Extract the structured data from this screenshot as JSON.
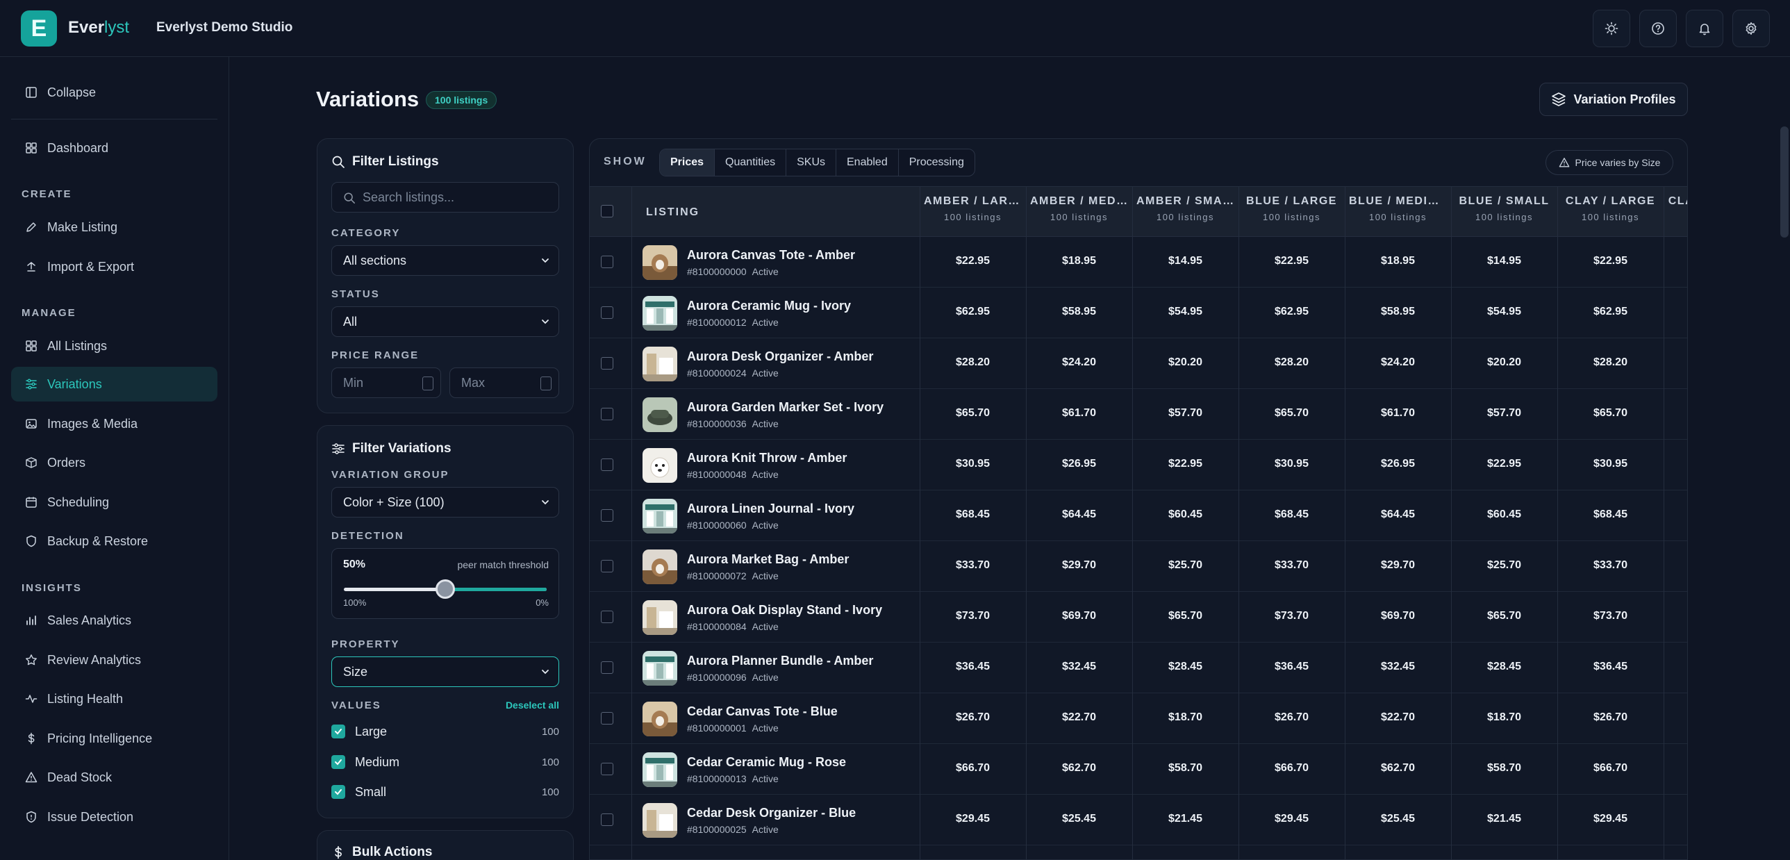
{
  "app": {
    "logo_letter": "E",
    "brand_main": "Ever",
    "brand_accent": "lyst",
    "studio": "Everlyst Demo Studio",
    "top_icons": [
      "sun-icon",
      "help-icon",
      "bell-icon",
      "gear-icon"
    ]
  },
  "sidebar": {
    "collapse": "Collapse",
    "dashboard": "Dashboard",
    "sections": {
      "create": "CREATE",
      "manage": "MANAGE",
      "insights": "INSIGHTS"
    },
    "create_items": [
      "Make Listing",
      "Import & Export"
    ],
    "manage_items": [
      "All Listings",
      "Variations",
      "Images & Media",
      "Orders",
      "Scheduling",
      "Backup & Restore"
    ],
    "insights_items": [
      "Sales Analytics",
      "Review Analytics",
      "Listing Health",
      "Pricing Intelligence",
      "Dead Stock",
      "Issue Detection"
    ],
    "active": "Variations"
  },
  "header": {
    "title": "Variations",
    "badge": "100 listings",
    "profiles_button": "Variation Profiles"
  },
  "filter_listings": {
    "title": "Filter Listings",
    "search_placeholder": "Search listings...",
    "category_label": "CATEGORY",
    "category_value": "All sections",
    "status_label": "STATUS",
    "status_value": "All",
    "price_label": "PRICE RANGE",
    "min_placeholder": "Min",
    "max_placeholder": "Max"
  },
  "filter_variations": {
    "title": "Filter Variations",
    "group_label": "VARIATION GROUP",
    "group_value": "Color + Size (100)",
    "detection_label": "DETECTION",
    "threshold_value": "50%",
    "threshold_caption": "peer match threshold",
    "threshold_fraction": 0.5,
    "slider_left": "100%",
    "slider_right": "0%",
    "property_label": "PROPERTY",
    "property_value": "Size",
    "values_label": "VALUES",
    "deselect_all": "Deselect all",
    "values": [
      {
        "label": "Large",
        "count": "100"
      },
      {
        "label": "Medium",
        "count": "100"
      },
      {
        "label": "Small",
        "count": "100"
      }
    ]
  },
  "bulk_actions": {
    "title": "Bulk Actions"
  },
  "toolbar": {
    "show_label": "SHOW",
    "tabs": [
      "Prices",
      "Quantities",
      "SKUs",
      "Enabled",
      "Processing"
    ],
    "active_tab": "Prices",
    "price_varies": "Price varies by Size"
  },
  "table": {
    "listing_header": "LISTING",
    "columns": [
      {
        "label": "AMBER / LARGE",
        "sub": "100 listings"
      },
      {
        "label": "AMBER / MEDIUM",
        "sub": "100 listings"
      },
      {
        "label": "AMBER / SMALL",
        "sub": "100 listings"
      },
      {
        "label": "BLUE / LARGE",
        "sub": "100 listings"
      },
      {
        "label": "BLUE / MEDIUM",
        "sub": "100 listings"
      },
      {
        "label": "BLUE / SMALL",
        "sub": "100 listings"
      },
      {
        "label": "CLAY / LARGE",
        "sub": "100 listings"
      },
      {
        "label": "CLAY / MEDIUM",
        "sub": ""
      }
    ],
    "rows": [
      {
        "name": "Aurora Canvas Tote - Amber",
        "id": "#8100000000",
        "status": "Active",
        "thumb": "cat",
        "prices": [
          "$22.95",
          "$18.95",
          "$14.95",
          "$22.95",
          "$18.95",
          "$14.95",
          "$22.95"
        ]
      },
      {
        "name": "Aurora Ceramic Mug - Ivory",
        "id": "#8100000012",
        "status": "Active",
        "thumb": "shop",
        "prices": [
          "$62.95",
          "$58.95",
          "$54.95",
          "$62.95",
          "$58.95",
          "$54.95",
          "$62.95"
        ]
      },
      {
        "name": "Aurora Desk Organizer - Amber",
        "id": "#8100000024",
        "status": "Active",
        "thumb": "room",
        "prices": [
          "$28.20",
          "$24.20",
          "$20.20",
          "$28.20",
          "$24.20",
          "$20.20",
          "$28.20"
        ]
      },
      {
        "name": "Aurora Garden Marker Set - Ivory",
        "id": "#8100000036",
        "status": "Active",
        "thumb": "hat",
        "prices": [
          "$65.70",
          "$61.70",
          "$57.70",
          "$65.70",
          "$61.70",
          "$57.70",
          "$65.70"
        ]
      },
      {
        "name": "Aurora Knit Throw - Amber",
        "id": "#8100000048",
        "status": "Active",
        "thumb": "dog",
        "prices": [
          "$30.95",
          "$26.95",
          "$22.95",
          "$30.95",
          "$26.95",
          "$22.95",
          "$30.95"
        ]
      },
      {
        "name": "Aurora Linen Journal - Ivory",
        "id": "#8100000060",
        "status": "Active",
        "thumb": "shop",
        "prices": [
          "$68.45",
          "$64.45",
          "$60.45",
          "$68.45",
          "$64.45",
          "$60.45",
          "$68.45"
        ]
      },
      {
        "name": "Aurora Market Bag - Amber",
        "id": "#8100000072",
        "status": "Active",
        "thumb": "cat2",
        "prices": [
          "$33.70",
          "$29.70",
          "$25.70",
          "$33.70",
          "$29.70",
          "$25.70",
          "$33.70"
        ]
      },
      {
        "name": "Aurora Oak Display Stand - Ivory",
        "id": "#8100000084",
        "status": "Active",
        "thumb": "room",
        "prices": [
          "$73.70",
          "$69.70",
          "$65.70",
          "$73.70",
          "$69.70",
          "$65.70",
          "$73.70"
        ]
      },
      {
        "name": "Aurora Planner Bundle - Amber",
        "id": "#8100000096",
        "status": "Active",
        "thumb": "shop",
        "prices": [
          "$36.45",
          "$32.45",
          "$28.45",
          "$36.45",
          "$32.45",
          "$28.45",
          "$36.45"
        ]
      },
      {
        "name": "Cedar Canvas Tote - Blue",
        "id": "#8100000001",
        "status": "Active",
        "thumb": "cat",
        "prices": [
          "$26.70",
          "$22.70",
          "$18.70",
          "$26.70",
          "$22.70",
          "$18.70",
          "$26.70"
        ]
      },
      {
        "name": "Cedar Ceramic Mug - Rose",
        "id": "#8100000013",
        "status": "Active",
        "thumb": "shop",
        "prices": [
          "$66.70",
          "$62.70",
          "$58.70",
          "$66.70",
          "$62.70",
          "$58.70",
          "$66.70"
        ]
      },
      {
        "name": "Cedar Desk Organizer - Blue",
        "id": "#8100000025",
        "status": "Active",
        "thumb": "room",
        "prices": [
          "$29.45",
          "$25.45",
          "$21.45",
          "$29.45",
          "$25.45",
          "$21.45",
          "$29.45"
        ]
      }
    ]
  },
  "colors": {
    "accent": "#2cc7bc",
    "background": "#0f1524",
    "panel": "#121a2a"
  }
}
